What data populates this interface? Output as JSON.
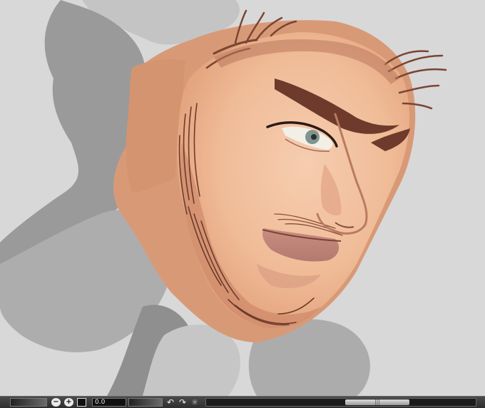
{
  "canvas": {
    "description_shapes": [
      "background-silhouette",
      "face-painting"
    ]
  },
  "statusbar": {
    "zoom_value": "0.0",
    "scroll_grip": "|||",
    "icons": {
      "zoom_out": "zoom-out-icon",
      "zoom_in": "zoom-in-icon",
      "fit": "fit-screen-icon",
      "rotate_left": "rotate-left-icon",
      "rotate_right": "rotate-right-icon",
      "reset_rotation": "reset-rotation-icon"
    }
  },
  "colors": {
    "background": "#d8d8d8",
    "silhouette_dark": "#9a9a9a",
    "silhouette_mid": "#a9a9a9",
    "silhouette_light": "#c4c4c4",
    "skin_base": "#d89a76",
    "skin_light": "#f3c7a6",
    "hair": "#7a4533"
  }
}
